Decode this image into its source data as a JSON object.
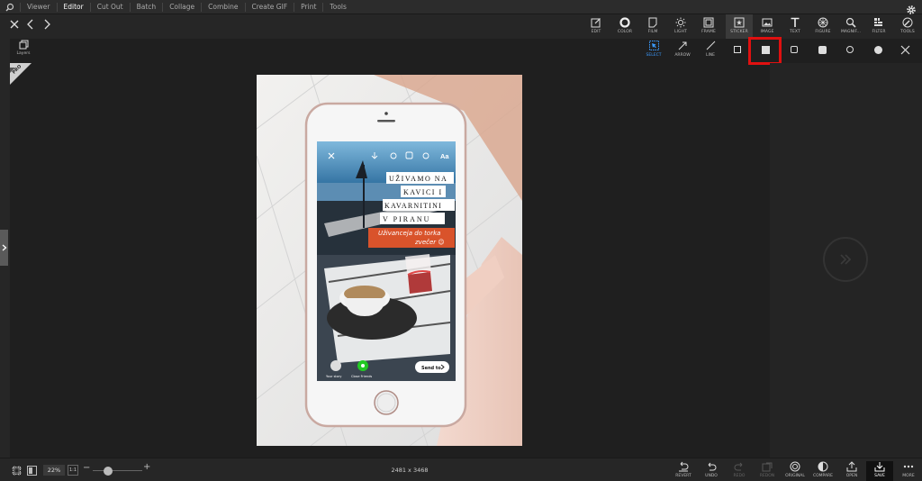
{
  "nav": {
    "items": [
      "Viewer",
      "Editor",
      "Cut Out",
      "Batch",
      "Collage",
      "Combine",
      "Create GIF",
      "Print",
      "Tools"
    ],
    "active": "Editor"
  },
  "main_tools": [
    {
      "id": "edit",
      "label": "EDIT",
      "icon": "edit-icon"
    },
    {
      "id": "color",
      "label": "COLOR",
      "icon": "color-icon"
    },
    {
      "id": "film",
      "label": "FILM",
      "icon": "film-icon"
    },
    {
      "id": "light",
      "label": "LIGHT",
      "icon": "light-icon"
    },
    {
      "id": "frame",
      "label": "FRAME",
      "icon": "frame-icon"
    },
    {
      "id": "sticker",
      "label": "STICKER",
      "icon": "sticker-icon"
    },
    {
      "id": "image",
      "label": "IMAGE",
      "icon": "image-icon"
    },
    {
      "id": "text",
      "label": "TEXT",
      "icon": "text-icon"
    },
    {
      "id": "figure",
      "label": "FIGURE",
      "icon": "figure-icon"
    },
    {
      "id": "magnifier",
      "label": "MAGNIF...",
      "icon": "magnifier-icon"
    },
    {
      "id": "filter",
      "label": "FILTER",
      "icon": "filter-icon"
    },
    {
      "id": "tools",
      "label": "TOOLS",
      "icon": "tools-icon"
    }
  ],
  "sub_tools": [
    {
      "id": "select",
      "label": "SELECT",
      "icon": "select-icon",
      "selected": true
    },
    {
      "id": "arrow",
      "label": "ARROW",
      "icon": "arrow-icon"
    },
    {
      "id": "line",
      "label": "LINE",
      "icon": "line-icon"
    }
  ],
  "shapes": [
    {
      "id": "square-outline",
      "icon": "square-outline-icon"
    },
    {
      "id": "square-filled",
      "icon": "square-filled-icon",
      "highlighted": true
    },
    {
      "id": "rounded-square-outline",
      "icon": "rounded-square-outline-icon"
    },
    {
      "id": "rounded-square-filled",
      "icon": "rounded-square-filled-icon"
    },
    {
      "id": "circle-outline",
      "icon": "circle-outline-icon"
    },
    {
      "id": "circle-filled",
      "icon": "circle-filled-icon"
    }
  ],
  "layers_label": "Layers",
  "pro_badge": "PRO",
  "zoom": {
    "value": "22%",
    "ratio_label": "1:1",
    "minus": "−",
    "plus": "+",
    "level": 0.22
  },
  "image_size": "2481 x 3468",
  "bottom_tools": [
    {
      "id": "revert",
      "label": "REVERT",
      "icon": "revert-icon",
      "enabled": true
    },
    {
      "id": "undo",
      "label": "UNDO",
      "icon": "undo-icon",
      "enabled": true
    },
    {
      "id": "redo",
      "label": "REDO",
      "icon": "redo-icon",
      "enabled": false
    },
    {
      "id": "redon",
      "label": "REDON",
      "icon": "redon-icon",
      "enabled": false
    },
    {
      "id": "original",
      "label": "ORIGINAL",
      "icon": "original-icon",
      "enabled": true
    },
    {
      "id": "compare",
      "label": "COMPARE",
      "icon": "compare-icon",
      "enabled": true
    },
    {
      "id": "open",
      "label": "OPEN",
      "icon": "open-icon",
      "enabled": true
    },
    {
      "id": "save",
      "label": "SAVE",
      "icon": "save-icon",
      "enabled": true
    },
    {
      "id": "more",
      "label": "MORE",
      "icon": "more-icon",
      "enabled": true
    }
  ],
  "photo": {
    "headline_lines": [
      "UŽIVAMO NA",
      "KAVICI I",
      "KAVARNITINI",
      "V PIRANU"
    ],
    "subtext_lines": [
      "Uživanceja do torka",
      "zvečer 😉"
    ],
    "story_labels": {
      "your_story": "Your story",
      "close_friends": "Close Friends",
      "send_to": "Send to"
    },
    "aa_label": "Aa"
  },
  "colors": {
    "accent": "#3b9bff",
    "highlight": "#e01010",
    "close_friends_green": "#22c922"
  }
}
